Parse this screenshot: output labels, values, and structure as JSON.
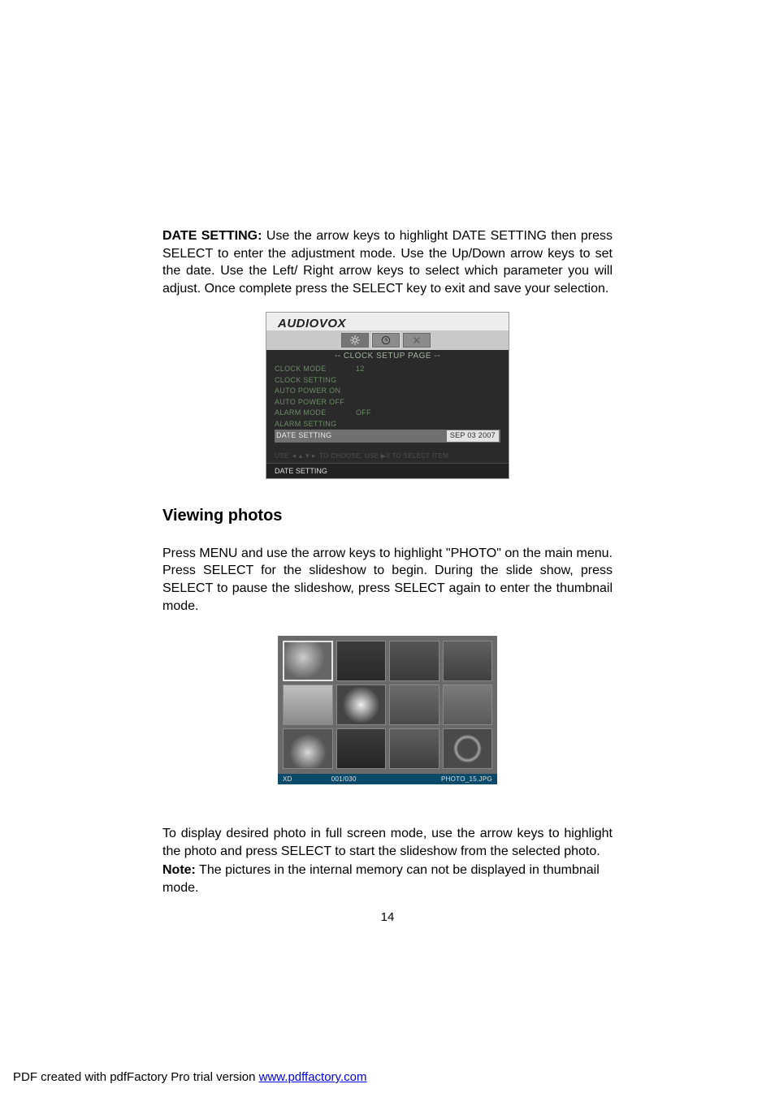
{
  "section1": {
    "heading_bold": "DATE SETTING:",
    "paragraph": " Use the arrow keys to highlight DATE SETTING then press SELECT to enter the adjustment mode.  Use the Up/Down arrow keys to set the date.  Use the Left/ Right arrow keys to select which parameter you will adjust. Once complete press the SELECT key to exit and save your selection."
  },
  "fig1": {
    "brand": "AUDIOVOX",
    "title": "--  CLOCK SETUP PAGE  --",
    "rows": [
      {
        "label": "CLOCK MODE",
        "value": "12"
      },
      {
        "label": "CLOCK SETTING",
        "value": ""
      },
      {
        "label": "AUTO POWER ON",
        "value": ""
      },
      {
        "label": "AUTO POWER OFF",
        "value": ""
      },
      {
        "label": "ALARM MODE",
        "value": "OFF"
      },
      {
        "label": "ALARM SETTING",
        "value": ""
      }
    ],
    "selected_row": {
      "label": "DATE SETTING",
      "value": "SEP  03  2007"
    },
    "hint": "USE ◄▲▼► TO CHOOSE, USE ▶II TO SELECT ITEM.",
    "footer": "DATE SETTING",
    "icons": {
      "gear": "gear-icon",
      "clock": "clock-icon",
      "close": "close-icon"
    }
  },
  "section2": {
    "heading": "Viewing photos",
    "paragraph": "Press  MENU and use the arrow keys to highlight \"PHOTO\" on the main menu. Press SELECT for the slideshow to begin. During the slide show, press SELECT to pause the slideshow, press SELECT again to enter the thumbnail mode."
  },
  "fig2": {
    "bar": {
      "left": "XD",
      "mid": "001/030",
      "right": "PHOTO_15.JPG"
    }
  },
  "section3": {
    "paragraph": "To display desired photo in full screen mode, use the arrow keys to highlight the photo and press  SELECT to start the slideshow from the selected photo.",
    "note_bold": "Note:",
    "note_rest": " The pictures in the internal memory can not be displayed in thumbnail mode."
  },
  "page_number": "14",
  "footer": {
    "prefix": "PDF created with pdfFactory Pro trial version ",
    "link_text": "www.pdffactory.com"
  }
}
